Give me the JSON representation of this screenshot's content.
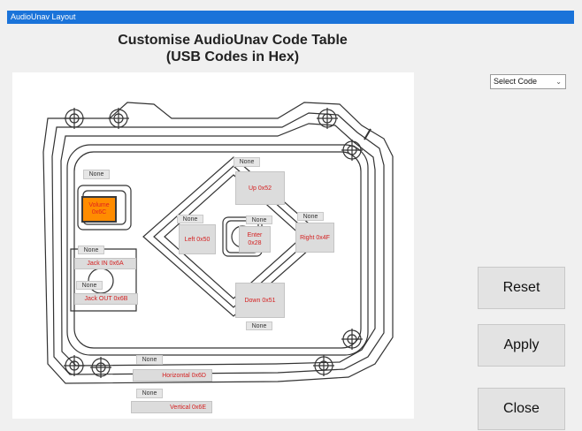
{
  "window": {
    "title": "AudioUnav Layout"
  },
  "heading": {
    "line1": "Customise AudioUnav Code Table",
    "line2": "(USB Codes in Hex)"
  },
  "select": {
    "value": "Select Code"
  },
  "buttons": {
    "reset": "Reset",
    "apply": "Apply",
    "close": "Close"
  },
  "placeholder": "None",
  "codes": {
    "volume": "Volume\n0x6C",
    "up": "Up 0x52",
    "left": "Left 0x50",
    "enter": "Enter\n0x28",
    "right": "Right 0x4F",
    "down": "Down 0x51",
    "jack_in": "Jack IN  0x6A",
    "jack_out": "Jack OUT  0x6B",
    "horizontal": "Horizontal  0x6D",
    "vertical": "Vertical  0x6E"
  },
  "colors": {
    "accent": "#1a73d9",
    "code_text": "#d42020",
    "volume_fill": "#ff8c00"
  }
}
